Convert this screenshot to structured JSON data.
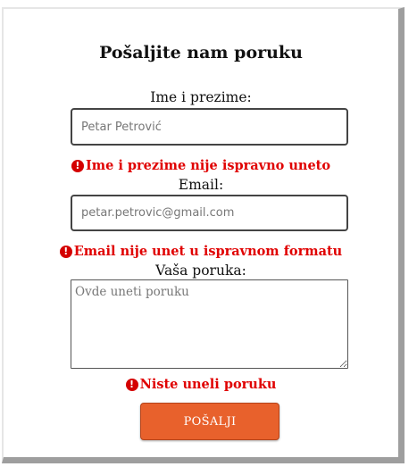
{
  "form": {
    "title": "Pošaljite nam poruku",
    "name": {
      "label": "Ime i prezime:",
      "placeholder": "Petar Petrović",
      "error": "Ime i prezime nije ispravno uneto"
    },
    "email": {
      "label": "Email:",
      "placeholder": "petar.petrovic@gmail.com",
      "error": "Email nije unet u ispravnom formatu"
    },
    "message": {
      "label": "Vaša poruka:",
      "placeholder": "Ovde uneti poruku",
      "error": "Niste uneli poruku"
    },
    "submit_label": "POŠALJI"
  },
  "icons": {
    "error": "exclamation-circle-icon"
  },
  "colors": {
    "accent": "#e8612c",
    "error": "#e00000",
    "shadow": "#9e9e9e"
  }
}
